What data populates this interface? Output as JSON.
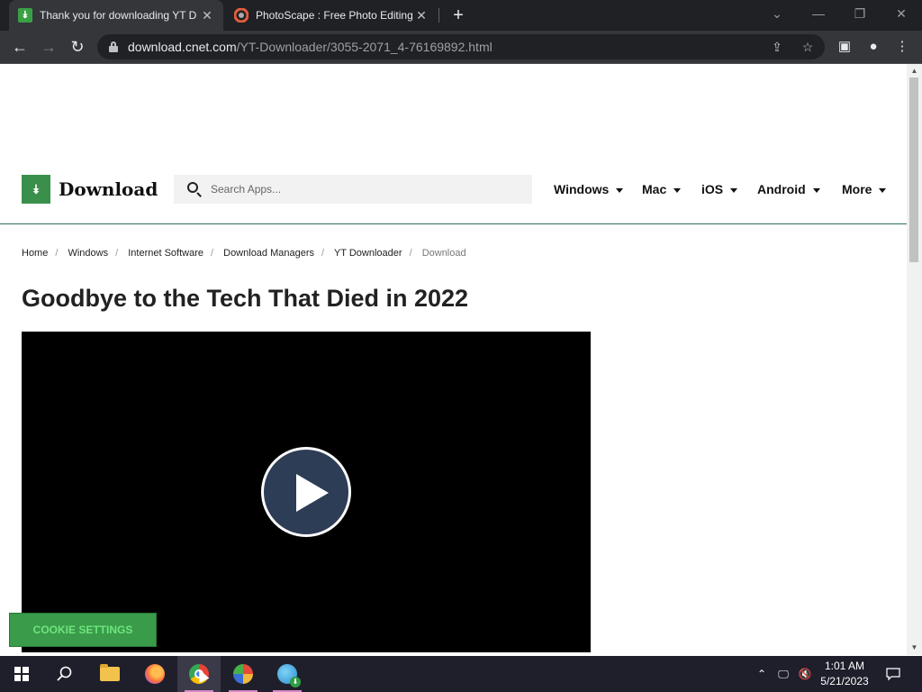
{
  "browser": {
    "tabs": [
      {
        "title": "Thank you for downloading YT D",
        "favicon": "download-logo-icon",
        "active": true
      },
      {
        "title": "PhotoScape : Free Photo Editing",
        "favicon": "photoscape-icon",
        "active": false
      }
    ],
    "new_tab_label": "+",
    "url_host": "download.cnet.com",
    "url_path": "/YT-Downloader/3055-2071_4-76169892.html"
  },
  "site": {
    "logo_text": "Download",
    "search_placeholder": "Search Apps...",
    "nav": [
      "Windows",
      "Mac",
      "iOS",
      "Android",
      "More"
    ],
    "brand_color": "#3a8f4a"
  },
  "breadcrumb": {
    "items": [
      "Home",
      "Windows",
      "Internet Software",
      "Download Managers",
      "YT Downloader"
    ],
    "current": "Download",
    "separator": "/"
  },
  "article": {
    "headline": "Goodbye to the Tech That Died in 2022"
  },
  "cookie_button": "COOKIE SETTINGS",
  "taskbar": {
    "time": "1:01 AM",
    "date": "5/21/2023"
  }
}
